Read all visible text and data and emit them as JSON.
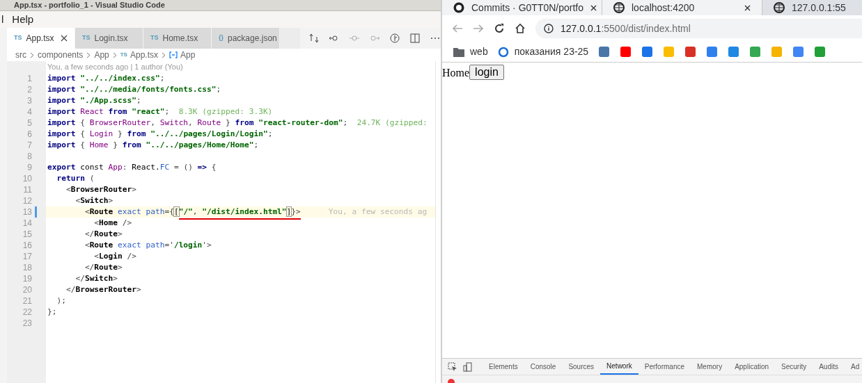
{
  "editor_window": {
    "title": "App.tsx - portfolio_1 - Visual Studio Code",
    "menu": [
      "l",
      "Help"
    ],
    "tabs": [
      {
        "badge": "TS",
        "label": "App.tsx",
        "selected": true
      },
      {
        "badge": "TS",
        "label": "Login.tsx",
        "selected": false
      },
      {
        "badge": "TS",
        "label": "Home.tsx",
        "selected": false
      },
      {
        "badge": "{}",
        "label": "package.json",
        "selected": false
      }
    ],
    "breadcrumbs": [
      {
        "label": "src",
        "kind": "folder"
      },
      {
        "label": "components",
        "kind": "folder"
      },
      {
        "label": "App",
        "kind": "folder"
      },
      {
        "badge": "TS",
        "label": "App.tsx",
        "kind": "file"
      },
      {
        "label": "App",
        "kind": "symbol"
      }
    ],
    "codelens": "You, a few seconds ago | 1 author (You)",
    "lines": [
      {
        "number": "1",
        "current": false,
        "tokens": [
          {
            "kind": "keyword",
            "text": "import"
          },
          {
            "kind": "string",
            "text": " \"../../index.css\""
          },
          {
            "kind": "punct",
            "text": ";"
          }
        ]
      },
      {
        "number": "2",
        "current": false,
        "tokens": [
          {
            "kind": "keyword",
            "text": "import"
          },
          {
            "kind": "string",
            "text": " \"../../media/fonts/fonts.css\""
          },
          {
            "kind": "punct",
            "text": ";"
          }
        ]
      },
      {
        "number": "3",
        "current": false,
        "tokens": [
          {
            "kind": "keyword",
            "text": "import"
          },
          {
            "kind": "string",
            "text": " \"./App.scss\""
          },
          {
            "kind": "punct",
            "text": ";"
          }
        ]
      },
      {
        "number": "4",
        "current": false,
        "tokens": [
          {
            "kind": "keyword",
            "text": "import"
          },
          {
            "kind": "ident",
            "text": " React"
          },
          {
            "kind": "keyword",
            "text": " from"
          },
          {
            "kind": "string",
            "text": " \"react\""
          },
          {
            "kind": "punct",
            "text": ";"
          },
          {
            "kind": "hint",
            "text": "  8.3K (gzipped: 3.3K)"
          }
        ]
      },
      {
        "number": "5",
        "current": false,
        "tokens": [
          {
            "kind": "keyword",
            "text": "import"
          },
          {
            "kind": "punct",
            "text": " { "
          },
          {
            "kind": "ident",
            "text": "BrowserRouter"
          },
          {
            "kind": "punct",
            "text": ", "
          },
          {
            "kind": "ident",
            "text": "Switch"
          },
          {
            "kind": "punct",
            "text": ", "
          },
          {
            "kind": "ident",
            "text": "Route"
          },
          {
            "kind": "punct",
            "text": " } "
          },
          {
            "kind": "keyword",
            "text": "from"
          },
          {
            "kind": "string",
            "text": " \"react-router-dom\""
          },
          {
            "kind": "punct",
            "text": ";"
          },
          {
            "kind": "hint",
            "text": "  24.7K (gzipped:"
          }
        ]
      },
      {
        "number": "6",
        "current": false,
        "tokens": [
          {
            "kind": "keyword",
            "text": "import"
          },
          {
            "kind": "punct",
            "text": " { "
          },
          {
            "kind": "ident",
            "text": "Login"
          },
          {
            "kind": "punct",
            "text": " } "
          },
          {
            "kind": "keyword",
            "text": "from"
          },
          {
            "kind": "string",
            "text": " \"../../pages/Login/Login\""
          },
          {
            "kind": "punct",
            "text": ";"
          }
        ]
      },
      {
        "number": "7",
        "current": false,
        "tokens": [
          {
            "kind": "keyword",
            "text": "import"
          },
          {
            "kind": "punct",
            "text": " { "
          },
          {
            "kind": "ident",
            "text": "Home"
          },
          {
            "kind": "punct",
            "text": " } "
          },
          {
            "kind": "keyword",
            "text": "from"
          },
          {
            "kind": "string",
            "text": " \"../../pages/Home/Home\""
          },
          {
            "kind": "punct",
            "text": ";"
          }
        ]
      },
      {
        "number": "8",
        "current": false
      },
      {
        "number": "9",
        "current": false,
        "tokens": [
          {
            "kind": "keyword",
            "text": "export"
          },
          {
            "kind": "plain",
            "text": " const "
          },
          {
            "kind": "ident",
            "text": "App"
          },
          {
            "kind": "punct",
            "text": ": "
          },
          {
            "kind": "plain",
            "text": "React."
          },
          {
            "kind": "attr",
            "text": "FC"
          },
          {
            "kind": "punct",
            "text": " = () "
          },
          {
            "kind": "keyword",
            "text": "=>"
          },
          {
            "kind": "punct",
            "text": " {"
          }
        ]
      },
      {
        "number": "10",
        "current": false,
        "tokens": [
          {
            "kind": "keyword",
            "text": "  return"
          },
          {
            "kind": "punct",
            "text": " ("
          }
        ]
      },
      {
        "number": "11",
        "current": false,
        "tokens": [
          {
            "kind": "punct",
            "text": "    <"
          },
          {
            "kind": "tag",
            "text": "BrowserRouter"
          },
          {
            "kind": "punct",
            "text": ">"
          }
        ]
      },
      {
        "number": "12",
        "current": false,
        "tokens": [
          {
            "kind": "punct",
            "text": "      <"
          },
          {
            "kind": "tag",
            "text": "Switch"
          },
          {
            "kind": "punct",
            "text": ">"
          }
        ]
      },
      {
        "number": "13",
        "current": true,
        "tokens": [
          {
            "kind": "punct",
            "text": "        <"
          },
          {
            "kind": "tag",
            "text": "Route"
          },
          {
            "kind": "attr",
            "text": " exact path"
          },
          {
            "kind": "punct",
            "text": "={"
          },
          {
            "kind": "bracket",
            "text": "["
          },
          {
            "kind": "string",
            "text": "\"/\"",
            "marked": true
          },
          {
            "kind": "punct",
            "text": ", ",
            "marked": true
          },
          {
            "kind": "string",
            "text": "\"/dist/index.html\"",
            "marked": true
          },
          {
            "kind": "bracket",
            "text": "]",
            "marked": true
          },
          {
            "kind": "punct",
            "text": "}>",
            "marked": true
          },
          {
            "kind": "blame",
            "text": "You, a few seconds ag"
          }
        ]
      },
      {
        "number": "14",
        "current": false,
        "tokens": [
          {
            "kind": "punct",
            "text": "          <"
          },
          {
            "kind": "tag",
            "text": "Home"
          },
          {
            "kind": "punct",
            "text": " />"
          }
        ]
      },
      {
        "number": "15",
        "current": false,
        "tokens": [
          {
            "kind": "punct",
            "text": "        </"
          },
          {
            "kind": "tag",
            "text": "Route"
          },
          {
            "kind": "punct",
            "text": ">"
          }
        ]
      },
      {
        "number": "16",
        "current": false,
        "tokens": [
          {
            "kind": "punct",
            "text": "        <"
          },
          {
            "kind": "tag",
            "text": "Route"
          },
          {
            "kind": "attr",
            "text": " exact path"
          },
          {
            "kind": "punct",
            "text": "='"
          },
          {
            "kind": "string",
            "text": "/login"
          },
          {
            "kind": "punct",
            "text": "'>"
          }
        ]
      },
      {
        "number": "17",
        "current": false,
        "tokens": [
          {
            "kind": "punct",
            "text": "          <"
          },
          {
            "kind": "tag",
            "text": "Login"
          },
          {
            "kind": "punct",
            "text": " />"
          }
        ]
      },
      {
        "number": "18",
        "current": false,
        "tokens": [
          {
            "kind": "punct",
            "text": "        </"
          },
          {
            "kind": "tag",
            "text": "Route"
          },
          {
            "kind": "punct",
            "text": ">"
          }
        ]
      },
      {
        "number": "19",
        "current": false,
        "tokens": [
          {
            "kind": "punct",
            "text": "      </"
          },
          {
            "kind": "tag",
            "text": "Switch"
          },
          {
            "kind": "punct",
            "text": ">"
          }
        ]
      },
      {
        "number": "20",
        "current": false,
        "tokens": [
          {
            "kind": "punct",
            "text": "    </"
          },
          {
            "kind": "tag",
            "text": "BrowserRouter"
          },
          {
            "kind": "punct",
            "text": ">"
          }
        ]
      },
      {
        "number": "21",
        "current": false,
        "tokens": [
          {
            "kind": "punct",
            "text": "  );"
          }
        ]
      },
      {
        "number": "22",
        "current": false,
        "tokens": [
          {
            "kind": "punct",
            "text": "};"
          }
        ]
      },
      {
        "number": "23",
        "current": false
      }
    ]
  },
  "browser": {
    "tabs": [
      {
        "label": "Commits · G0TT0N/portfo",
        "kind": "github",
        "selected": false
      },
      {
        "label": "localhost:4200",
        "kind": "globe",
        "selected": false
      },
      {
        "label": "127.0.0.1:55",
        "kind": "globe",
        "selected": true
      }
    ],
    "url_host": "127.0.0.1",
    "url_rest": ":5500/dist/index.html",
    "bookmarks": [
      {
        "label": "web",
        "kind": "folder"
      },
      {
        "label": "показания 23-25",
        "kind": "site"
      }
    ],
    "page": {
      "text": "Home",
      "button": "login"
    },
    "devtools_tabs": [
      {
        "label": "Elements",
        "selected": false
      },
      {
        "label": "Console",
        "selected": false
      },
      {
        "label": "Sources",
        "selected": false
      },
      {
        "label": "Network",
        "selected": true
      },
      {
        "label": "Performance",
        "selected": false
      },
      {
        "label": "Memory",
        "selected": false
      },
      {
        "label": "Application",
        "selected": false
      },
      {
        "label": "Security",
        "selected": false
      },
      {
        "label": "Audits",
        "selected": false
      },
      {
        "label": "Ad",
        "selected": false
      }
    ]
  }
}
